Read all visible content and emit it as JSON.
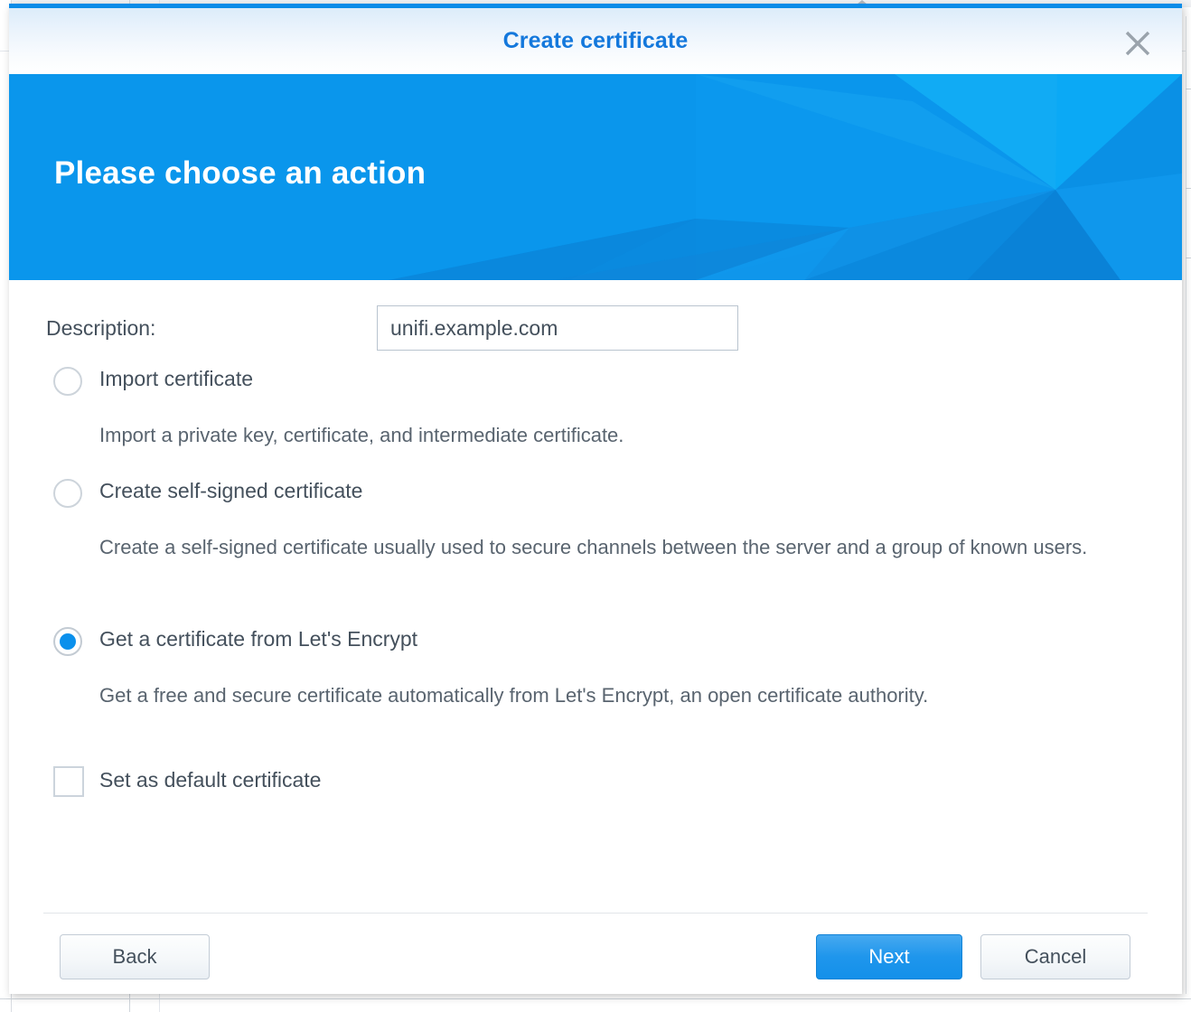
{
  "window": {
    "title": "Create certificate",
    "close_icon": "close-icon",
    "accent_color": "#0a90ec",
    "title_color": "#1478dc"
  },
  "banner": {
    "heading": "Please choose an action",
    "background_color": "#0a96ec"
  },
  "form": {
    "description_label": "Description:",
    "description_value": "unifi.example.com",
    "description_placeholder": "",
    "options": [
      {
        "label": "Import certificate",
        "description": "Import a private key, certificate, and intermediate certificate.",
        "selected": false
      },
      {
        "label": "Create self-signed certificate",
        "description": "Create a self-signed certificate usually used to secure channels between the server and a group of known users.",
        "selected": false
      },
      {
        "label": "Get a certificate from Let's Encrypt",
        "description": "Get a free and secure certificate automatically from Let's Encrypt, an open certificate authority.",
        "selected": true
      }
    ],
    "default_certificate": {
      "label": "Set as default certificate",
      "checked": false
    }
  },
  "footer": {
    "back_label": "Back",
    "next_label": "Next",
    "cancel_label": "Cancel"
  }
}
